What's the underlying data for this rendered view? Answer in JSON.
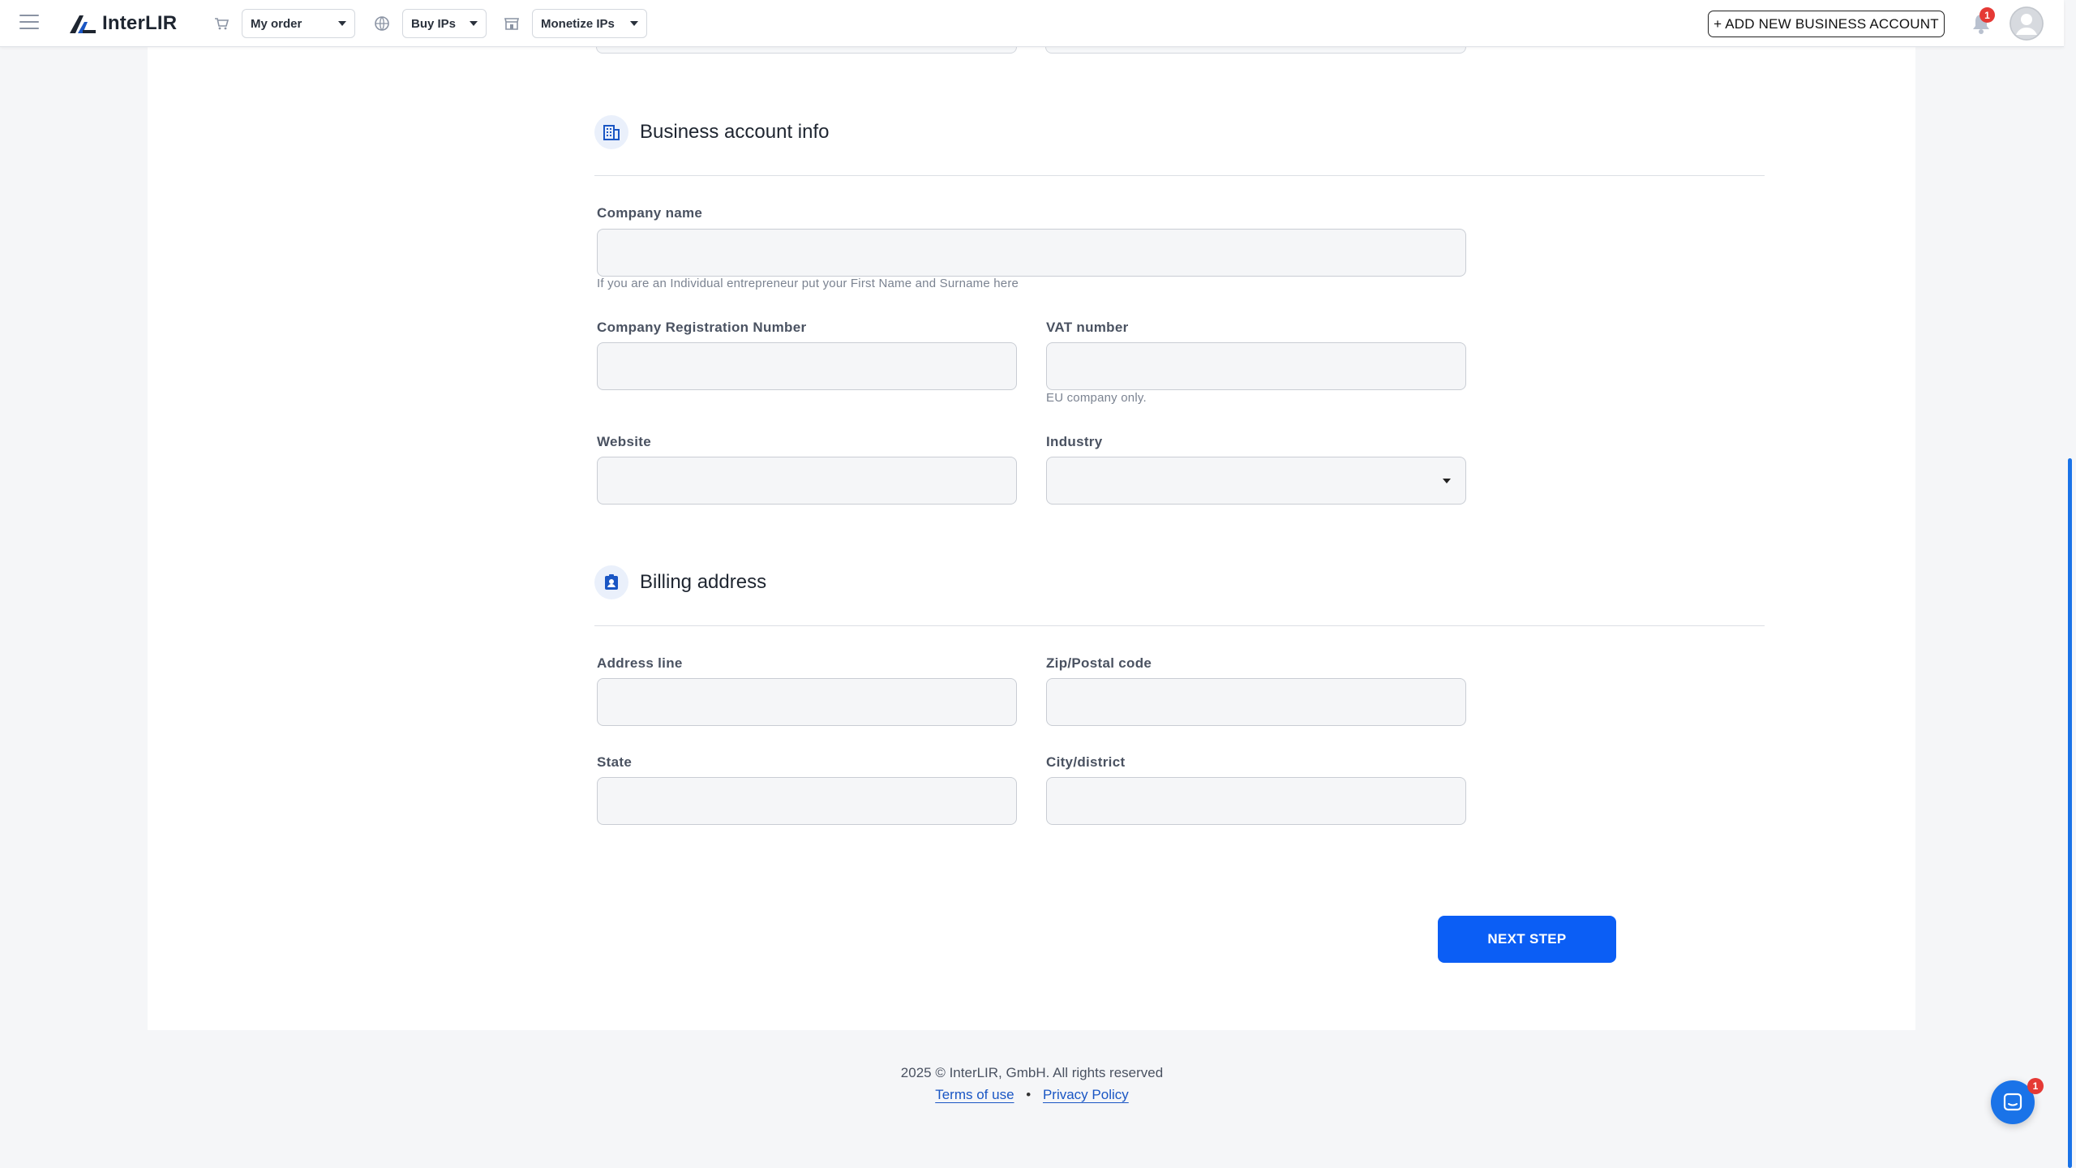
{
  "header": {
    "logo_text": "InterLIR",
    "nav": [
      {
        "label": "My order",
        "icon": "cart-icon"
      },
      {
        "label": "Buy IPs",
        "icon": "globe-icon"
      },
      {
        "label": "Monetize IPs",
        "icon": "store-icon"
      }
    ],
    "add_account_label": "+ ADD NEW BUSINESS ACCOUNT",
    "notifications_count": "1"
  },
  "business_section": {
    "title": "Business account info",
    "icon": "building-icon",
    "company_name": {
      "label": "Company name",
      "value": "",
      "hint": "If you are an Individual entrepreneur put your First Name and Surname here"
    },
    "registration_number": {
      "label": "Company Registration Number",
      "value": ""
    },
    "vat_number": {
      "label": "VAT number",
      "value": "",
      "hint": "EU company only."
    },
    "website": {
      "label": "Website",
      "value": ""
    },
    "industry": {
      "label": "Industry",
      "value": ""
    }
  },
  "billing_section": {
    "title": "Billing address",
    "icon": "contact-card-icon",
    "address_line": {
      "label": "Address line",
      "value": ""
    },
    "zip": {
      "label": "Zip/Postal code",
      "value": ""
    },
    "state": {
      "label": "State",
      "value": ""
    },
    "city": {
      "label": "City/district",
      "value": ""
    }
  },
  "actions": {
    "next_label": "NEXT STEP"
  },
  "footer": {
    "copyright": "2025 © InterLIR, GmbH. All rights reserved",
    "terms_label": "Terms of use",
    "separator": "•",
    "privacy_label": "Privacy Policy"
  },
  "chat": {
    "badge_count": "1"
  },
  "colors": {
    "primary": "#0b5ef5",
    "badge": "#e53935"
  }
}
